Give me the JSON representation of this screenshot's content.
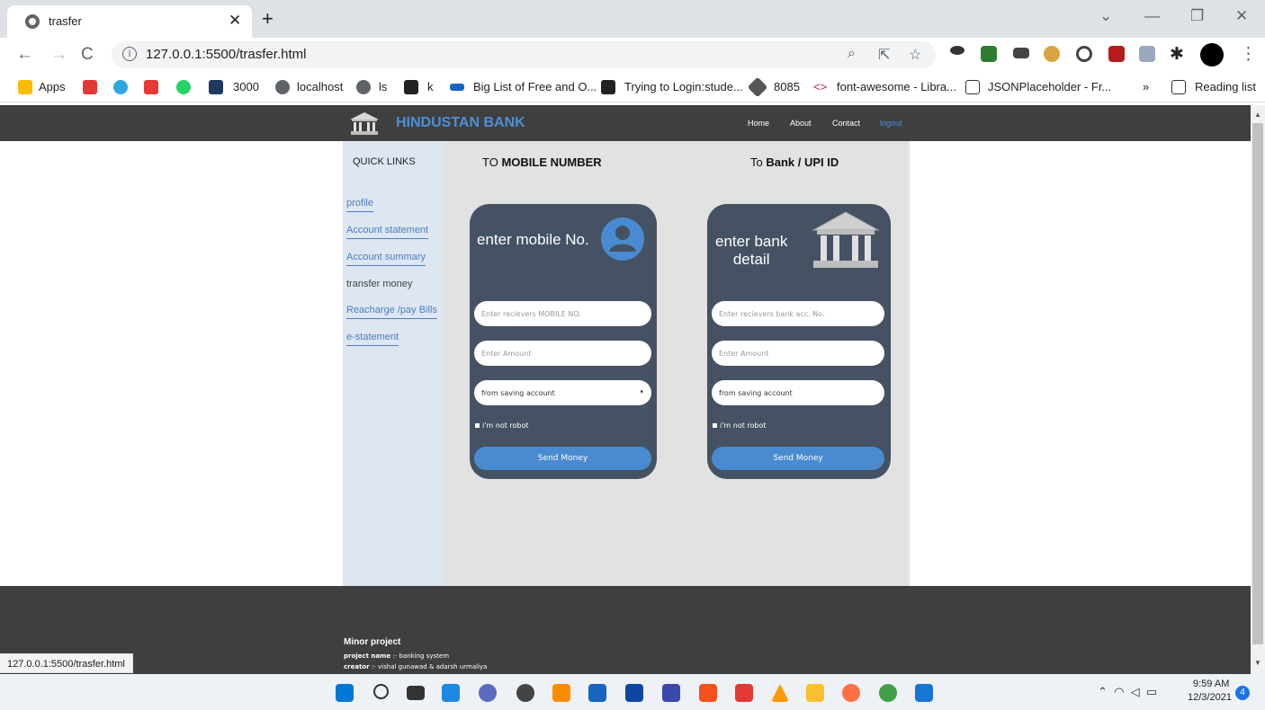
{
  "browser": {
    "tab_title": "trasfer",
    "url": "127.0.0.1:5500/trasfer.html",
    "status_url": "127.0.0.1:5500/trasfer.html",
    "bookmarks": [
      "Apps",
      "3000",
      "localhost",
      "ls",
      "k",
      "Big List of Free and O...",
      "Trying to Login:stude...",
      "8085",
      "font-awesome - Libra...",
      "JSONPlaceholder - Fr...",
      "»",
      "Reading list"
    ]
  },
  "site": {
    "brand": "HINDUSTAN BANK",
    "nav": [
      "Home",
      "About",
      "Contact",
      "logout"
    ],
    "sidebar": {
      "title": "QUICK LINKS",
      "links": [
        "profile",
        "Account statement",
        "Account summary",
        "transfer money",
        "Reacharge /pay Bills",
        "e-statement"
      ]
    },
    "mobile": {
      "title_prefix": "TO ",
      "title_bold": "MOBILE NUMBER",
      "heading": "enter mobile No.",
      "field_placeholder": "Enter recievers MOBILE NO.",
      "amount_placeholder": "Enter Amount",
      "select_value": "from saving account",
      "robot": "i'm not robot",
      "button": "Send Money"
    },
    "bank": {
      "title_prefix": "To ",
      "title_bold": "Bank / UPI ID",
      "heading_line1": "enter  bank",
      "heading_line2": "detail",
      "field_placeholder": "Enter recievers bank acc. No.",
      "amount_placeholder": "Enter Amount",
      "select_value": "from saving account",
      "robot": "i'm not robot",
      "button": "Send Money"
    },
    "footer": {
      "title": "Minor project",
      "project_label": "project name",
      "project_value": ":- banking system",
      "creator_label": "creator",
      "creator_value": ":- vishal gunawad & adarsh urmaliya"
    }
  },
  "taskbar": {
    "time": "9:59 AM",
    "date": "12/3/2021",
    "notifications": "4"
  },
  "colors": {
    "navbar": "#3f3f3f",
    "brand": "#4c8fd6",
    "card": "#455263",
    "button": "#4a8ad0",
    "sidebar": "#dde6f1",
    "main": "#e2e2e2"
  }
}
